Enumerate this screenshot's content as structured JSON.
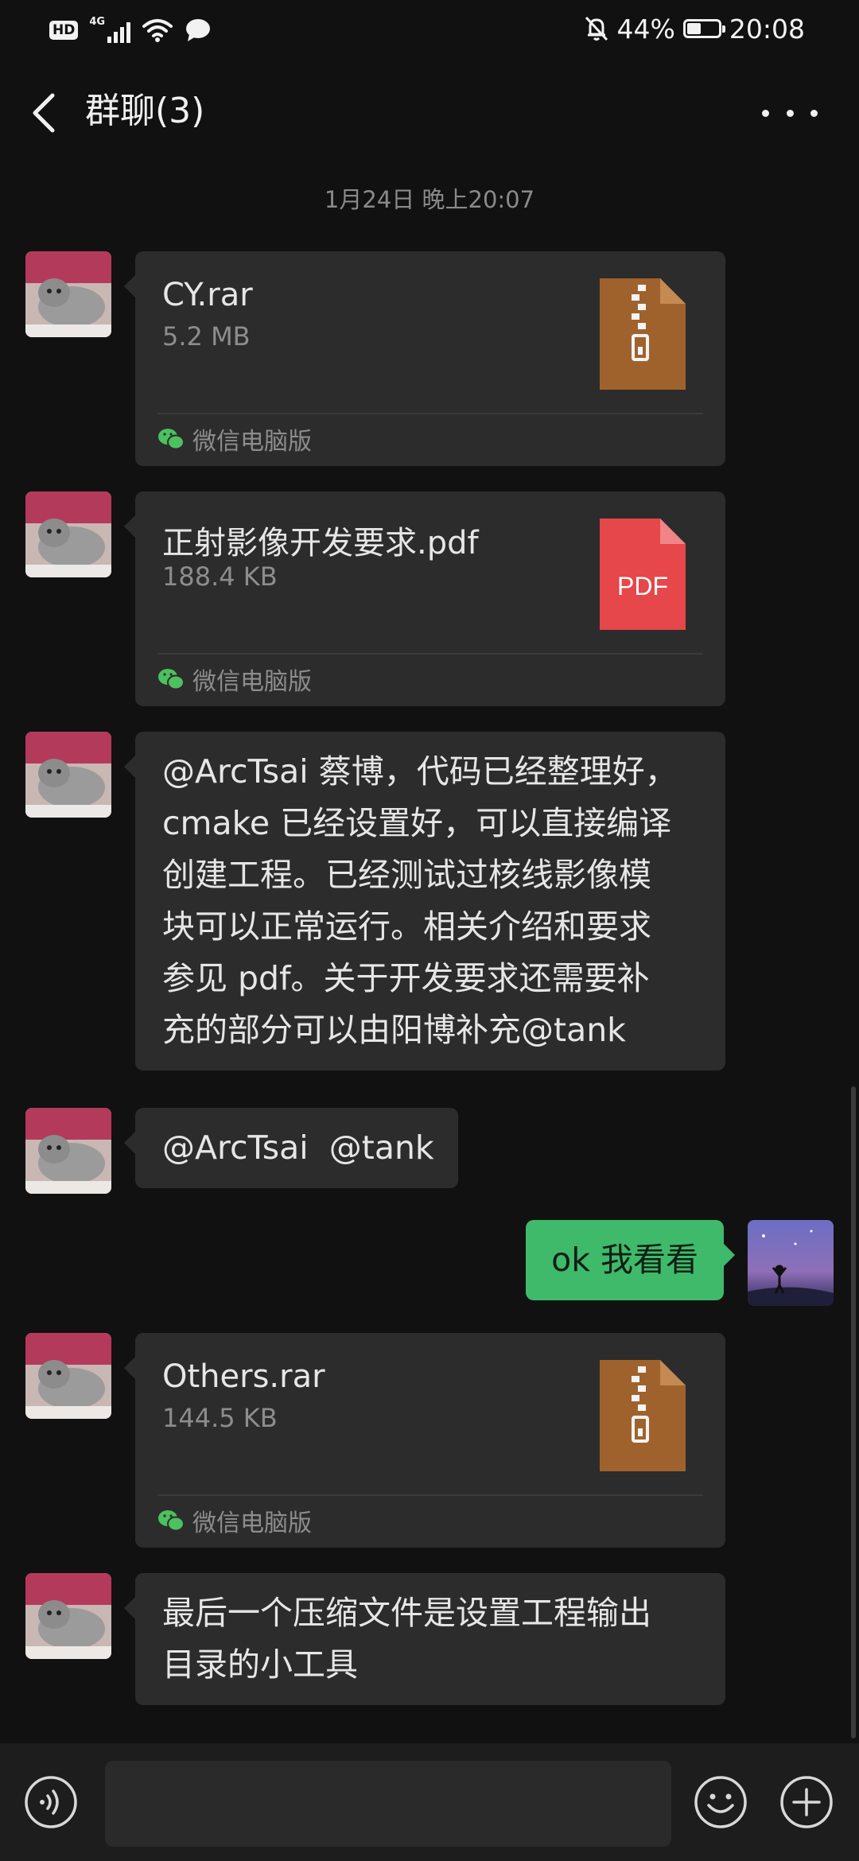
{
  "status_bar": {
    "hd": "HD",
    "network": "4G",
    "battery_pct": "44%",
    "battery_level": 0.44,
    "time": "20:08"
  },
  "header": {
    "title": "群聊(3)",
    "back_icon": "back-chevron-icon",
    "more_icon": "more-dots-icon"
  },
  "timestamp": "1月24日 晚上20:07",
  "messages": [
    {
      "type": "file",
      "name": "CY.rar",
      "size": "5.2 MB",
      "icon": "zip-file-icon",
      "source": "微信电脑版"
    },
    {
      "type": "file",
      "name": "正射影像开发要求.pdf",
      "size": "188.4 KB",
      "icon": "pdf-file-icon",
      "icon_label": "PDF",
      "source": "微信电脑版"
    },
    {
      "type": "text",
      "lines": [
        "@ArcTsai 蔡博，代码已经整理好，",
        "cmake 已经设置好，可以直接编译",
        "创建工程。已经测试过核线影像模",
        "块可以正常运行。相关介绍和要求",
        "参见 pdf。关于开发要求还需要补",
        "充的部分可以由阳博补充@tank"
      ]
    },
    {
      "type": "text",
      "lines": [
        "@ArcTsai  @tank"
      ]
    },
    {
      "type": "text",
      "from": "me",
      "lines": [
        "ok 我看看"
      ]
    },
    {
      "type": "file",
      "name": "Others.rar",
      "size": "144.5 KB",
      "icon": "zip-file-icon",
      "source": "微信电脑版"
    },
    {
      "type": "text",
      "lines": [
        "最后一个压缩文件是设置工程输出",
        "目录的小工具"
      ]
    }
  ],
  "colors": {
    "background": "#111111",
    "bubble": "#2c2c2c",
    "my_bubble": "#3fba6a",
    "zip": "#a0622c",
    "pdf": "#e5474a",
    "wechat_green": "#4cc15f"
  },
  "input_bar": {
    "voice_icon": "voice-icon",
    "emoji_icon": "emoji-icon",
    "plus_icon": "plus-icon"
  }
}
